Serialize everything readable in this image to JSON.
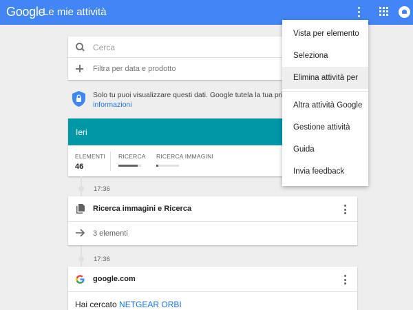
{
  "header": {
    "logo": "Google",
    "title": "Le mie attività"
  },
  "search": {
    "placeholder": "Cerca",
    "filter_label": "Filtra per data e prodotto"
  },
  "privacy": {
    "text": "Solo tu puoi visualizzare questi dati. Google tutela la tua privacy e la",
    "link": "informazioni"
  },
  "day": {
    "label": "Ieri",
    "stats": [
      {
        "label": "ELEMENTI",
        "value": "46"
      },
      {
        "label": "RICERCA",
        "level": 0.85
      },
      {
        "label": "RICERCA IMMAGINI",
        "level": 0.1
      }
    ]
  },
  "timeline": [
    {
      "time": "17:36",
      "title": "Ricerca immagini e Ricerca",
      "icon": "document-icon",
      "count": "3 elementi"
    },
    {
      "time": "17:36",
      "title": "google.com",
      "icon": "google-g-icon",
      "result_prefix": "Hai cercato",
      "result_query": "NETGEAR ORBI"
    }
  ],
  "menu": {
    "items": [
      "Vista per elemento",
      "Seleziona",
      "Elimina attività per",
      "Altra attività Google",
      "Gestione attività",
      "Guida",
      "Invia feedback"
    ],
    "active_index": 2
  },
  "colors": {
    "header": "#4285f4",
    "day_header": "#0097a7",
    "link": "#1a73e8",
    "background": "#eeeeee"
  }
}
